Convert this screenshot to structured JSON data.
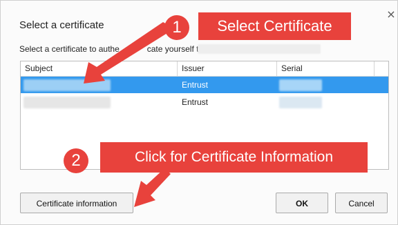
{
  "dialog": {
    "title": "Select a certificate",
    "description": "Select a certificate to authe",
    "description_cont": "cate yourself to",
    "close_glyph": "×"
  },
  "table": {
    "columns": [
      "Subject",
      "Issuer",
      "Serial"
    ],
    "rows": [
      {
        "issuer": "Entrust",
        "selected": true
      },
      {
        "issuer": "Entrust",
        "selected": false
      }
    ]
  },
  "buttons": {
    "cert_info": "Certificate information",
    "ok": "OK",
    "cancel": "Cancel"
  },
  "annotations": {
    "step1_number": "1",
    "step1_label": "Select Certificate",
    "step2_number": "2",
    "step2_label": "Click for Certificate Information",
    "accent_color": "#e8423c"
  }
}
